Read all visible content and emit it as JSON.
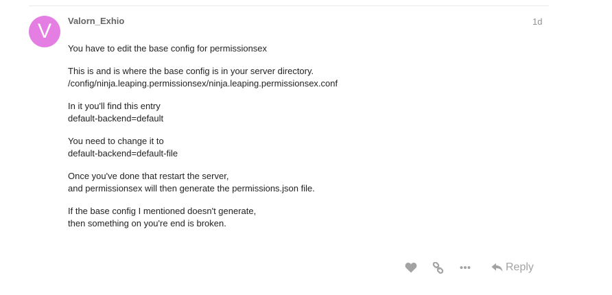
{
  "post": {
    "avatar_letter": "V",
    "avatar_color": "#e57ee3",
    "username": "Valorn_Exhio",
    "date": "1d",
    "paragraphs": [
      {
        "lines": [
          "You have to edit the base config for permissionsex"
        ]
      },
      {
        "lines": [
          "This is and is where the base config is in your server directory.",
          "/config/ninja.leaping.permissionsex/ninja.leaping.permissionsex.conf"
        ]
      },
      {
        "lines": [
          "In it you'll find this entry",
          "default-backend=default"
        ]
      },
      {
        "lines": [
          "You need to change it to",
          "default-backend=default-file"
        ]
      },
      {
        "lines": [
          "Once you've done that restart the server,",
          "and permissionsex will then generate the permissions.json file."
        ]
      },
      {
        "lines": [
          "If the base config I mentioned doesn't generate,",
          "then something on you're end is broken."
        ]
      }
    ]
  },
  "actions": {
    "like_icon": "heart-icon",
    "link_icon": "link-icon",
    "more_icon": "ellipsis-icon",
    "reply_icon": "reply-arrow-icon",
    "reply_label": "Reply",
    "icon_color": "#a3a3a3"
  }
}
